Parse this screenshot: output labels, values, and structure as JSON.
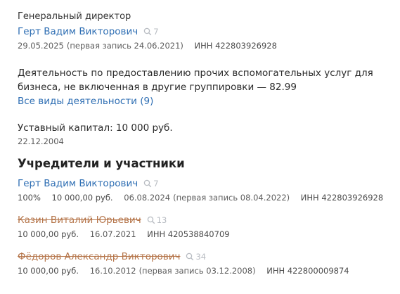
{
  "director": {
    "role": "Генеральный директор",
    "name": "Герт Вадим Викторович",
    "search_count": "7",
    "date": "29.05.2025",
    "first_record": "(первая запись 24.06.2021)",
    "inn": "ИНН 422803926928"
  },
  "activity": {
    "text": "Деятельность по предоставлению прочих вспомогательных услуг для бизнеса, не включенная в другие группировки — 82.99",
    "all_link": "Все виды деятельности (9)"
  },
  "capital": {
    "text": "Уставный капитал: 10 000 руб.",
    "date": "22.12.2004"
  },
  "founders": {
    "title": "Учредители и участники",
    "items": [
      {
        "name": "Герт Вадим Викторович",
        "search_count": "7",
        "share": "100%",
        "amount": "10 000,00 руб.",
        "date": "06.08.2024",
        "first_record": "(первая запись 08.04.2022)",
        "inn": "ИНН 422803926928"
      },
      {
        "name": "Казин Виталий Юрьевич",
        "search_count": "13",
        "amount": "10 000,00 руб.",
        "date": "16.07.2021",
        "inn": "ИНН 420538840709"
      },
      {
        "name": "Фёдоров Александр Викторович",
        "search_count": "34",
        "amount": "10 000,00 руб.",
        "date": "16.10.2012",
        "first_record": "(первая запись 03.12.2008)",
        "inn": "ИНН 422800009874"
      }
    ]
  },
  "colors": {
    "link": "#2e6eb3",
    "former_link": "#b5754a",
    "icon": "#b8bcc2"
  }
}
